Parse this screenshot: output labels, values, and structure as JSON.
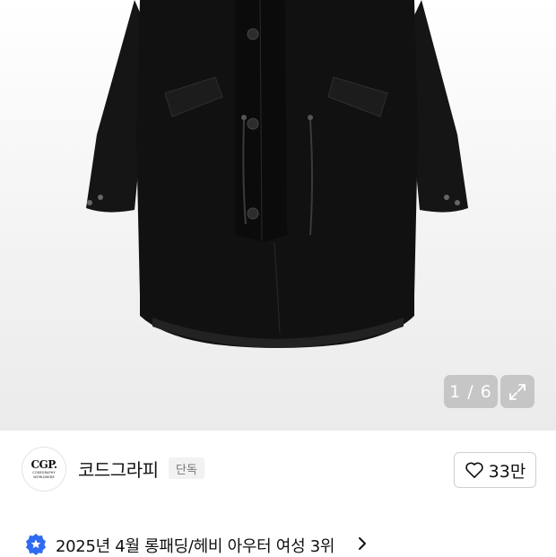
{
  "gallery": {
    "image_alt": "black long parka coat",
    "page_indicator": "1 / 6",
    "current_page": 1,
    "total_pages": 6,
    "expand_icon": "expand-icon"
  },
  "brand": {
    "logo_main": "CGP.",
    "logo_sub_1": "CODEGRAPHY",
    "logo_sub_2": "WORLDWIDE",
    "name": "코드그라피",
    "badge": "단독"
  },
  "like": {
    "icon": "heart-outline-icon",
    "count": "33만"
  },
  "ranking": {
    "icon": "star-badge-icon",
    "text": "2025년 4월 롱패딩/헤비 아우터 여성 3위",
    "accent_color": "#2f6bf2"
  }
}
